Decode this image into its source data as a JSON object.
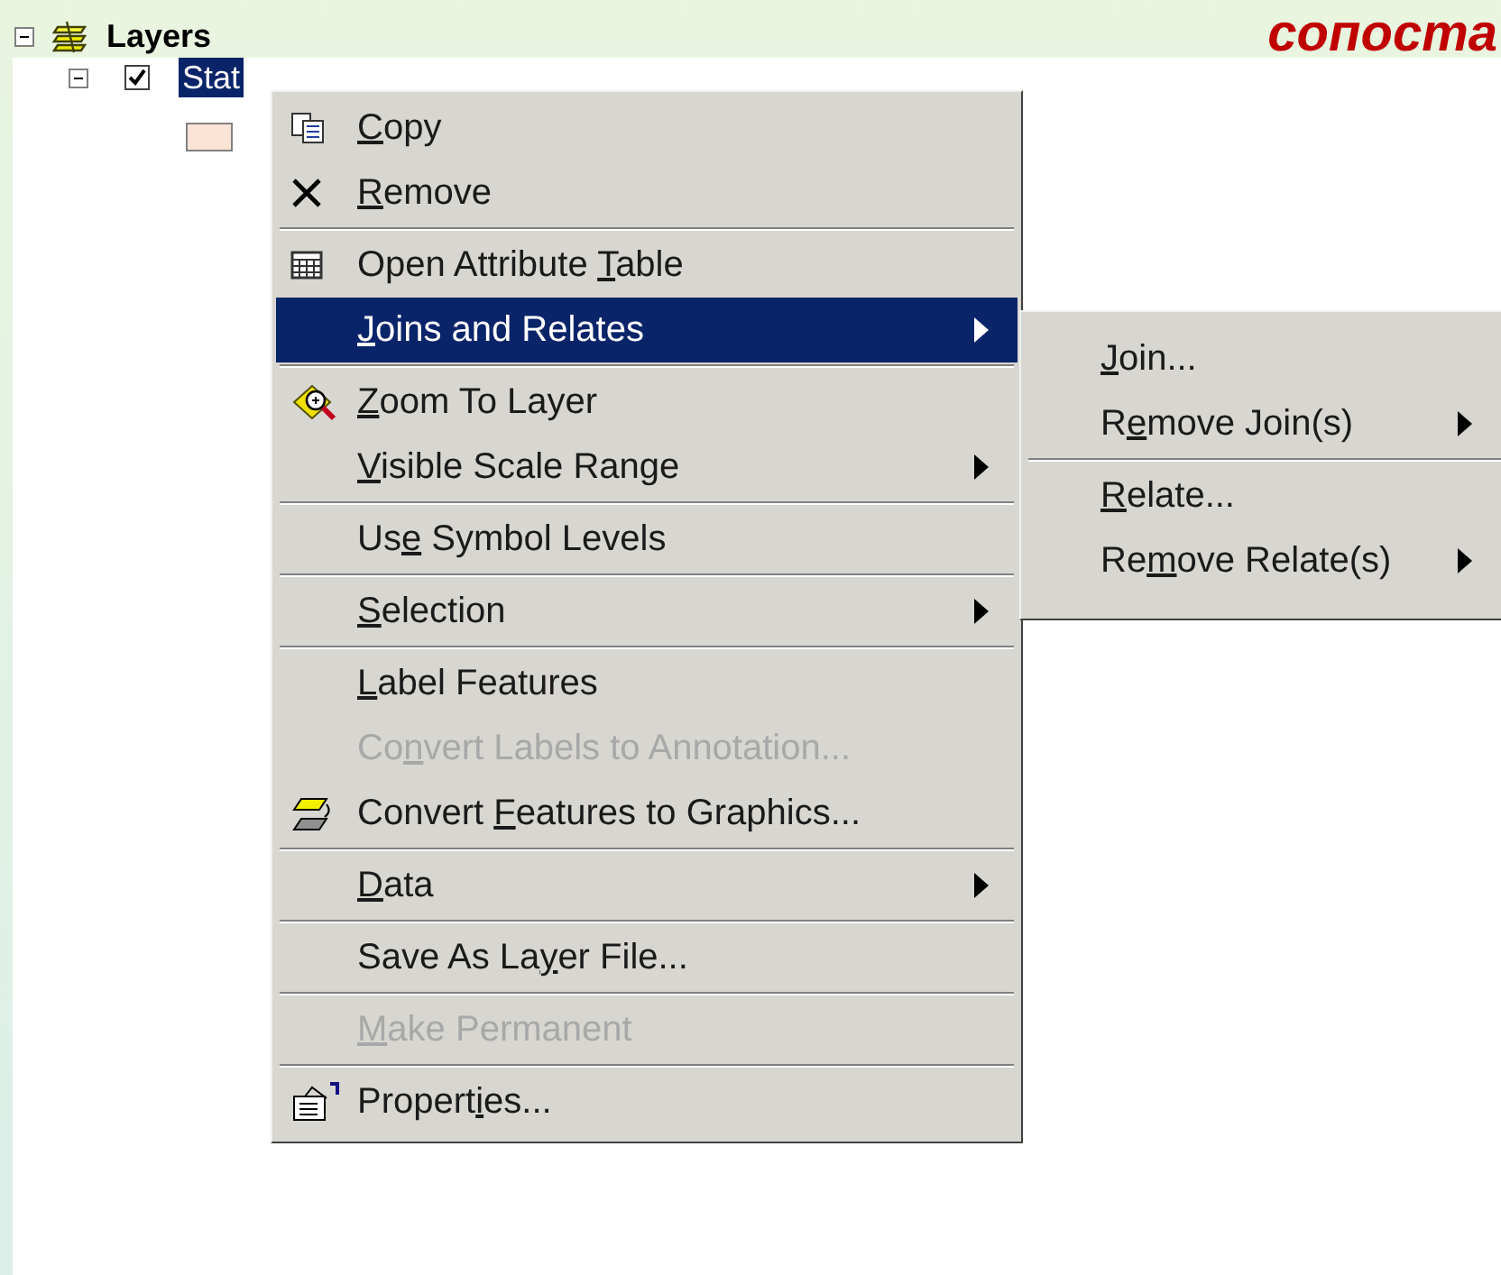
{
  "slide_title": "сопоста",
  "tree": {
    "root": {
      "label": "Layers",
      "expanded": true
    },
    "layer": {
      "label": "Stat",
      "expanded": true,
      "checked": true,
      "selected": true
    }
  },
  "context_menu": [
    {
      "kind": "item",
      "label": {
        "key": "C",
        "after": "opy"
      },
      "disabled": false,
      "selected": false,
      "submenu": false
    },
    {
      "kind": "item",
      "label": {
        "key": "R",
        "after": "emove"
      },
      "disabled": false,
      "selected": false,
      "submenu": false
    },
    {
      "kind": "separator"
    },
    {
      "kind": "item",
      "label": {
        "before": "Open Attribute ",
        "key": "T",
        "after": "able"
      },
      "disabled": false,
      "selected": false,
      "submenu": false
    },
    {
      "kind": "item",
      "label": {
        "key": "J",
        "after": "oins and Relates"
      },
      "disabled": false,
      "selected": true,
      "submenu": true
    },
    {
      "kind": "separator"
    },
    {
      "kind": "item",
      "label": {
        "key": "Z",
        "after": "oom To Layer"
      },
      "disabled": false,
      "selected": false,
      "submenu": false
    },
    {
      "kind": "item",
      "label": {
        "key": "V",
        "after": "isible Scale Range"
      },
      "disabled": false,
      "selected": false,
      "submenu": true
    },
    {
      "kind": "separator"
    },
    {
      "kind": "item",
      "label": {
        "before": "Us",
        "key": "e",
        "after": " Symbol Levels"
      },
      "disabled": false,
      "selected": false,
      "submenu": false
    },
    {
      "kind": "separator"
    },
    {
      "kind": "item",
      "label": {
        "key": "S",
        "after": "election"
      },
      "disabled": false,
      "selected": false,
      "submenu": true
    },
    {
      "kind": "separator"
    },
    {
      "kind": "item",
      "label": {
        "key": "L",
        "after": "abel Features"
      },
      "disabled": false,
      "selected": false,
      "submenu": false
    },
    {
      "kind": "item",
      "label": {
        "before": "Co",
        "key": "n",
        "after": "vert Labels to Annotation..."
      },
      "disabled": true,
      "selected": false,
      "submenu": false
    },
    {
      "kind": "item",
      "label": {
        "before": "Convert ",
        "key": "F",
        "after": "eatures to Graphics..."
      },
      "disabled": false,
      "selected": false,
      "submenu": false
    },
    {
      "kind": "separator"
    },
    {
      "kind": "item",
      "label": {
        "key": "D",
        "after": "ata"
      },
      "disabled": false,
      "selected": false,
      "submenu": true
    },
    {
      "kind": "separator"
    },
    {
      "kind": "item",
      "label": {
        "before": "Save As La",
        "key": "y",
        "after": "er File..."
      },
      "disabled": false,
      "selected": false,
      "submenu": false
    },
    {
      "kind": "separator"
    },
    {
      "kind": "item",
      "label": {
        "key": "M",
        "after": "ake Permanent"
      },
      "disabled": true,
      "selected": false,
      "submenu": false
    },
    {
      "kind": "separator"
    },
    {
      "kind": "item",
      "label": {
        "before": "Propert",
        "key": "i",
        "after": "es..."
      },
      "disabled": false,
      "selected": false,
      "submenu": false
    }
  ],
  "submenu": [
    {
      "kind": "item",
      "label": {
        "key": "J",
        "after": "oin..."
      },
      "disabled": false,
      "selected": false,
      "submenu": false
    },
    {
      "kind": "item",
      "label": {
        "before": "R",
        "key": "e",
        "after": "move Join(s)"
      },
      "disabled": false,
      "selected": false,
      "submenu": true
    },
    {
      "kind": "separator"
    },
    {
      "kind": "item",
      "label": {
        "key": "R",
        "after": "elate..."
      },
      "disabled": false,
      "selected": false,
      "submenu": false
    },
    {
      "kind": "item",
      "label": {
        "before": "Re",
        "key": "m",
        "after": "ove Relate(s)"
      },
      "disabled": false,
      "selected": false,
      "submenu": true
    }
  ]
}
